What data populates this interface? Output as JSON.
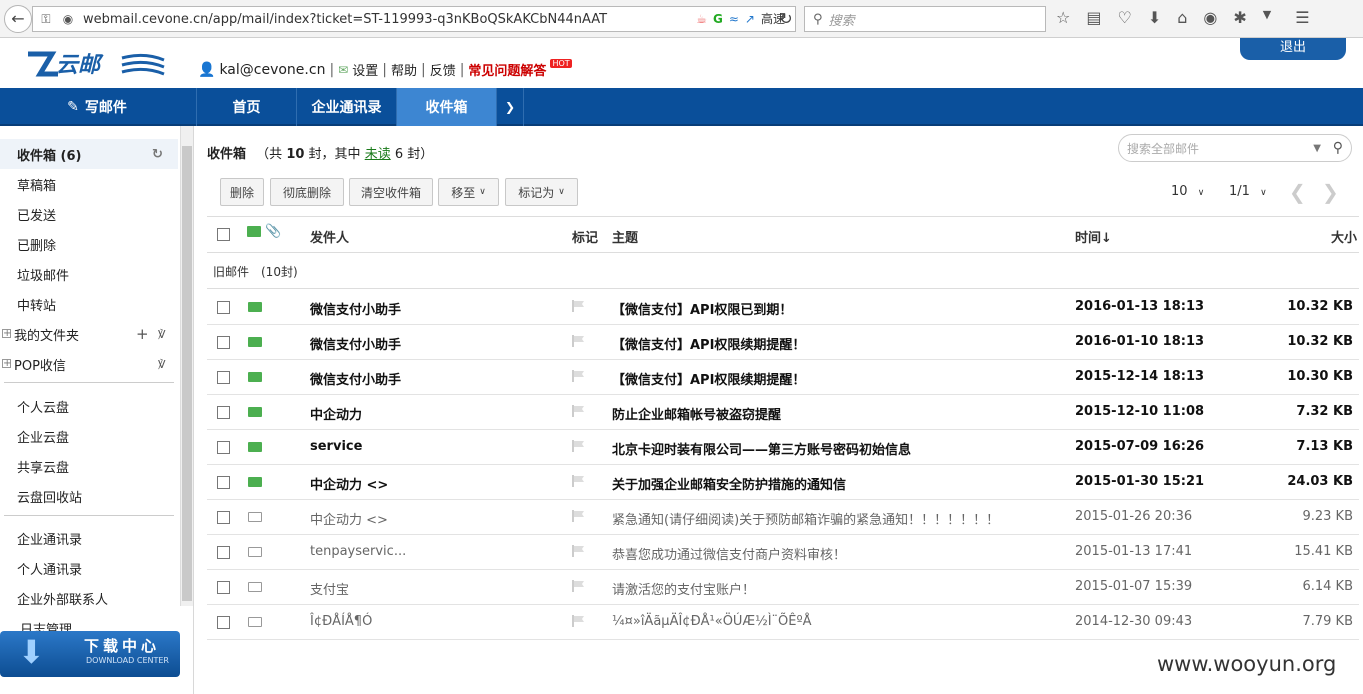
{
  "browser": {
    "url": "webmail.cevone.cn/app/mail/index?ticket=ST-119993-q3nKBoQSkAKCbN44nAAT",
    "ext_label": "高速",
    "search_placeholder": "搜索"
  },
  "header": {
    "user": "kal@cevone.cn",
    "links": [
      "设置",
      "帮助",
      "反馈"
    ],
    "faq": "常见问题解答",
    "hot": "HOT",
    "logout": "退出"
  },
  "nav": {
    "compose": "写邮件",
    "tabs": [
      "首页",
      "企业通讯录",
      "收件箱"
    ]
  },
  "sidebar": {
    "inbox": "收件箱 (6)",
    "folders": [
      "草稿箱",
      "已发送",
      "已删除",
      "垃圾邮件",
      "中转站"
    ],
    "my_folders": "我的文件夹",
    "pop": "POP收信",
    "cloud": [
      "个人云盘",
      "企业云盘",
      "共享云盘",
      "云盘回收站"
    ],
    "contacts": [
      "企业通讯录",
      "个人通讯录",
      "企业外部联系人"
    ],
    "partial": "日志管理",
    "download_title": "下载中心",
    "download_sub": "DOWNLOAD CENTER"
  },
  "main": {
    "title": "收件箱",
    "summary_pre": "（共",
    "total": "10",
    "summary_mid": "封，其中",
    "unread_label": "未读",
    "unread_count": "6",
    "summary_post": "封）",
    "search_placeholder": "搜索全部邮件",
    "buttons": [
      "删除",
      "彻底删除",
      "清空收件箱",
      "移至",
      "标记为"
    ],
    "page_size": "10",
    "page": "1/1",
    "columns": {
      "sender": "发件人",
      "mark": "标记",
      "subject": "主题",
      "time": "时间↓",
      "size": "大小"
    },
    "group": "旧邮件　(10封)",
    "rows": [
      {
        "sender": "微信支付小助手",
        "subject": "【微信支付】API权限已到期！",
        "time": "2016-01-13 18:13",
        "size": "10.32 KB",
        "unread": true
      },
      {
        "sender": "微信支付小助手",
        "subject": "【微信支付】API权限续期提醒！",
        "time": "2016-01-10 18:13",
        "size": "10.32 KB",
        "unread": true
      },
      {
        "sender": "微信支付小助手",
        "subject": "【微信支付】API权限续期提醒！",
        "time": "2015-12-14 18:13",
        "size": "10.30 KB",
        "unread": true
      },
      {
        "sender": "中企动力",
        "subject": "防止企业邮箱帐号被盗窃提醒",
        "time": "2015-12-10 11:08",
        "size": "7.32 KB",
        "unread": true
      },
      {
        "sender": "service",
        "subject": "北京卡迎时装有限公司——第三方账号密码初始信息",
        "time": "2015-07-09 16:26",
        "size": "7.13 KB",
        "unread": true
      },
      {
        "sender": "中企动力 <>",
        "subject": "关于加强企业邮箱安全防护措施的通知信",
        "time": "2015-01-30 15:21",
        "size": "24.03 KB",
        "unread": true
      },
      {
        "sender": "中企动力 <>",
        "subject": "紧急通知(请仔细阅读)关于预防邮箱诈骗的紧急通知！！！！！！！",
        "time": "2015-01-26 20:36",
        "size": "9.23 KB",
        "unread": false
      },
      {
        "sender": "tenpayservic...",
        "subject": "恭喜您成功通过微信支付商户资料审核！",
        "time": "2015-01-13 17:41",
        "size": "15.41 KB",
        "unread": false
      },
      {
        "sender": "支付宝",
        "subject": "请激活您的支付宝账户！",
        "time": "2015-01-07 15:39",
        "size": "6.14 KB",
        "unread": false
      },
      {
        "sender": "Î¢ÐÅÍÅ¶Ó",
        "subject": "¼¤»îÄãµÄÎ¢ÐÅ¹«ÖÚÆ½Ì¨ÕÊºÅ",
        "time": "2014-12-30 09:43",
        "size": "7.79 KB",
        "unread": false
      }
    ]
  },
  "watermark": "www.wooyun.org"
}
